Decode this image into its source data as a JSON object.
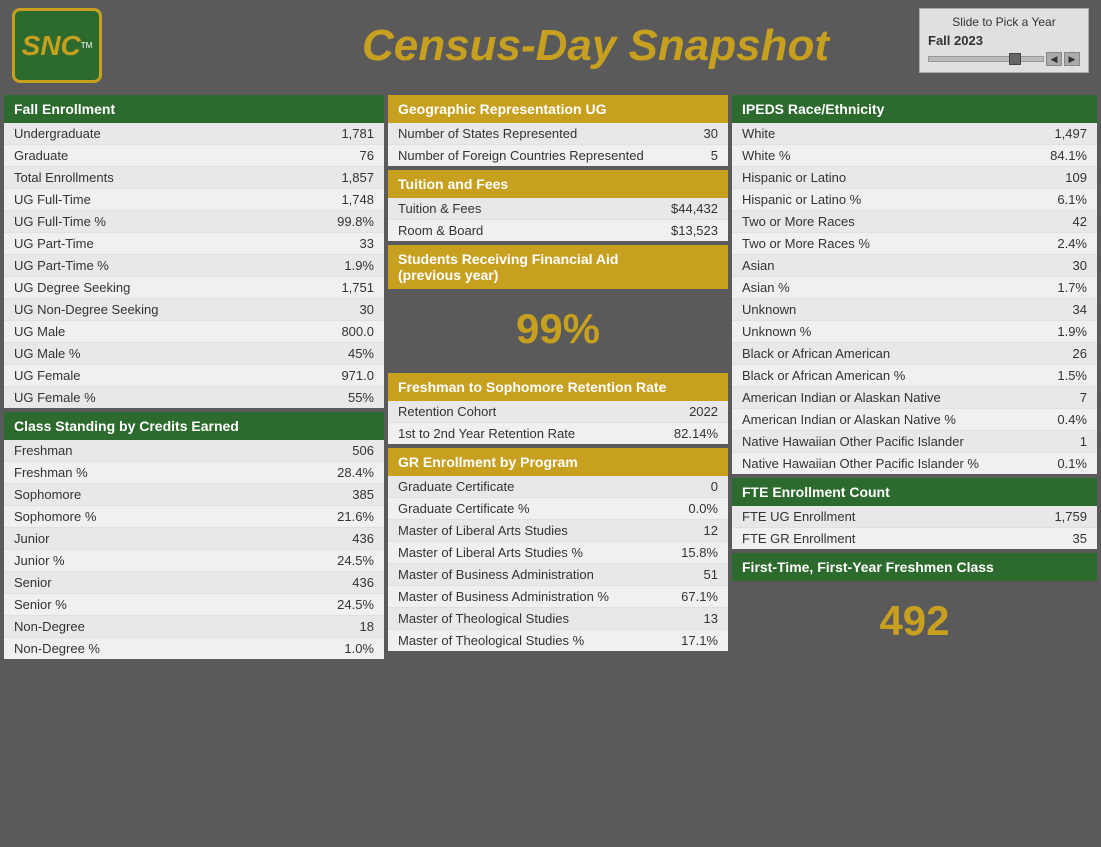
{
  "header": {
    "logo_text": "SNC",
    "title": "Census-Day Snapshot",
    "year_picker_label": "Slide to Pick a Year",
    "year_value": "Fall 2023"
  },
  "fall_enrollment": {
    "header": "Fall Enrollment",
    "rows": [
      {
        "label": "Undergraduate",
        "value": "1,781"
      },
      {
        "label": "Graduate",
        "value": "76"
      },
      {
        "label": "Total Enrollments",
        "value": "1,857"
      },
      {
        "label": "UG Full-Time",
        "value": "1,748"
      },
      {
        "label": "UG Full-Time %",
        "value": "99.8%"
      },
      {
        "label": "UG Part-Time",
        "value": "33"
      },
      {
        "label": "UG Part-Time %",
        "value": "1.9%"
      },
      {
        "label": "UG Degree Seeking",
        "value": "1,751"
      },
      {
        "label": "UG Non-Degree Seeking",
        "value": "30"
      },
      {
        "label": "UG Male",
        "value": "800.0"
      },
      {
        "label": "UG Male %",
        "value": "45%"
      },
      {
        "label": "UG Female",
        "value": "971.0"
      },
      {
        "label": "UG Female %",
        "value": "55%"
      }
    ]
  },
  "class_standing": {
    "header": "Class Standing by Credits Earned",
    "rows": [
      {
        "label": "Freshman",
        "value": "506"
      },
      {
        "label": "Freshman %",
        "value": "28.4%"
      },
      {
        "label": "Sophomore",
        "value": "385"
      },
      {
        "label": "Sophomore %",
        "value": "21.6%"
      },
      {
        "label": "Junior",
        "value": "436"
      },
      {
        "label": "Junior %",
        "value": "24.5%"
      },
      {
        "label": "Senior",
        "value": "436"
      },
      {
        "label": "Senior %",
        "value": "24.5%"
      },
      {
        "label": "Non-Degree",
        "value": "18"
      },
      {
        "label": "Non-Degree %",
        "value": "1.0%"
      }
    ]
  },
  "geo_rep": {
    "header": "Geographic Representation UG",
    "rows": [
      {
        "label": "Number of States Represented",
        "value": "30"
      },
      {
        "label": "Number of Foreign Countries Represented",
        "value": "5"
      }
    ]
  },
  "tuition": {
    "header": "Tuition and Fees",
    "rows": [
      {
        "label": "Tuition & Fees",
        "value": "$44,432"
      },
      {
        "label": "Room & Board",
        "value": "$13,523"
      }
    ]
  },
  "financial_aid": {
    "header": "Students Receiving Financial Aid\n(previous year)",
    "header_line1": "Students Receiving Financial Aid",
    "header_line2": "(previous year)",
    "value": "99%"
  },
  "retention": {
    "header": "Freshman to Sophomore Retention Rate",
    "rows": [
      {
        "label": "Retention Cohort",
        "value": "2022"
      },
      {
        "label": "1st to 2nd Year Retention Rate",
        "value": "82.14%"
      }
    ]
  },
  "gr_enrollment": {
    "header": "GR Enrollment by Program",
    "rows": [
      {
        "label": "Graduate Certificate",
        "value": "0"
      },
      {
        "label": "Graduate Certificate %",
        "value": "0.0%"
      },
      {
        "label": "Master of Liberal Arts Studies",
        "value": "12"
      },
      {
        "label": "Master of Liberal Arts Studies %",
        "value": "15.8%"
      },
      {
        "label": "Master of Business Administration",
        "value": "51"
      },
      {
        "label": "Master of Business Administration %",
        "value": "67.1%"
      },
      {
        "label": "Master of Theological Studies",
        "value": "13"
      },
      {
        "label": "Master of Theological Studies %",
        "value": "17.1%"
      }
    ]
  },
  "ipeds": {
    "header": "IPEDS Race/Ethnicity",
    "rows": [
      {
        "label": "White",
        "value": "1,497"
      },
      {
        "label": "White %",
        "value": "84.1%"
      },
      {
        "label": "Hispanic or Latino",
        "value": "109"
      },
      {
        "label": "Hispanic or Latino %",
        "value": "6.1%"
      },
      {
        "label": "Two or More Races",
        "value": "42"
      },
      {
        "label": "Two or More Races %",
        "value": "2.4%"
      },
      {
        "label": "Asian",
        "value": "30"
      },
      {
        "label": "Asian %",
        "value": "1.7%"
      },
      {
        "label": "Unknown",
        "value": "34"
      },
      {
        "label": "Unknown %",
        "value": "1.9%"
      },
      {
        "label": "Black or African American",
        "value": "26"
      },
      {
        "label": "Black or African American %",
        "value": "1.5%"
      },
      {
        "label": "American Indian or Alaskan Native",
        "value": "7"
      },
      {
        "label": "American Indian or Alaskan Native %",
        "value": "0.4%"
      },
      {
        "label": "Native Hawaiian Other Pacific Islander",
        "value": "1"
      },
      {
        "label": "Native Hawaiian Other Pacific Islander %",
        "value": "0.1%"
      }
    ]
  },
  "fte": {
    "header": "FTE Enrollment Count",
    "rows": [
      {
        "label": "FTE UG Enrollment",
        "value": "1,759"
      },
      {
        "label": "FTE GR Enrollment",
        "value": "35"
      }
    ]
  },
  "ftfy": {
    "header": "First-Time, First-Year Freshmen Class",
    "value": "492"
  }
}
